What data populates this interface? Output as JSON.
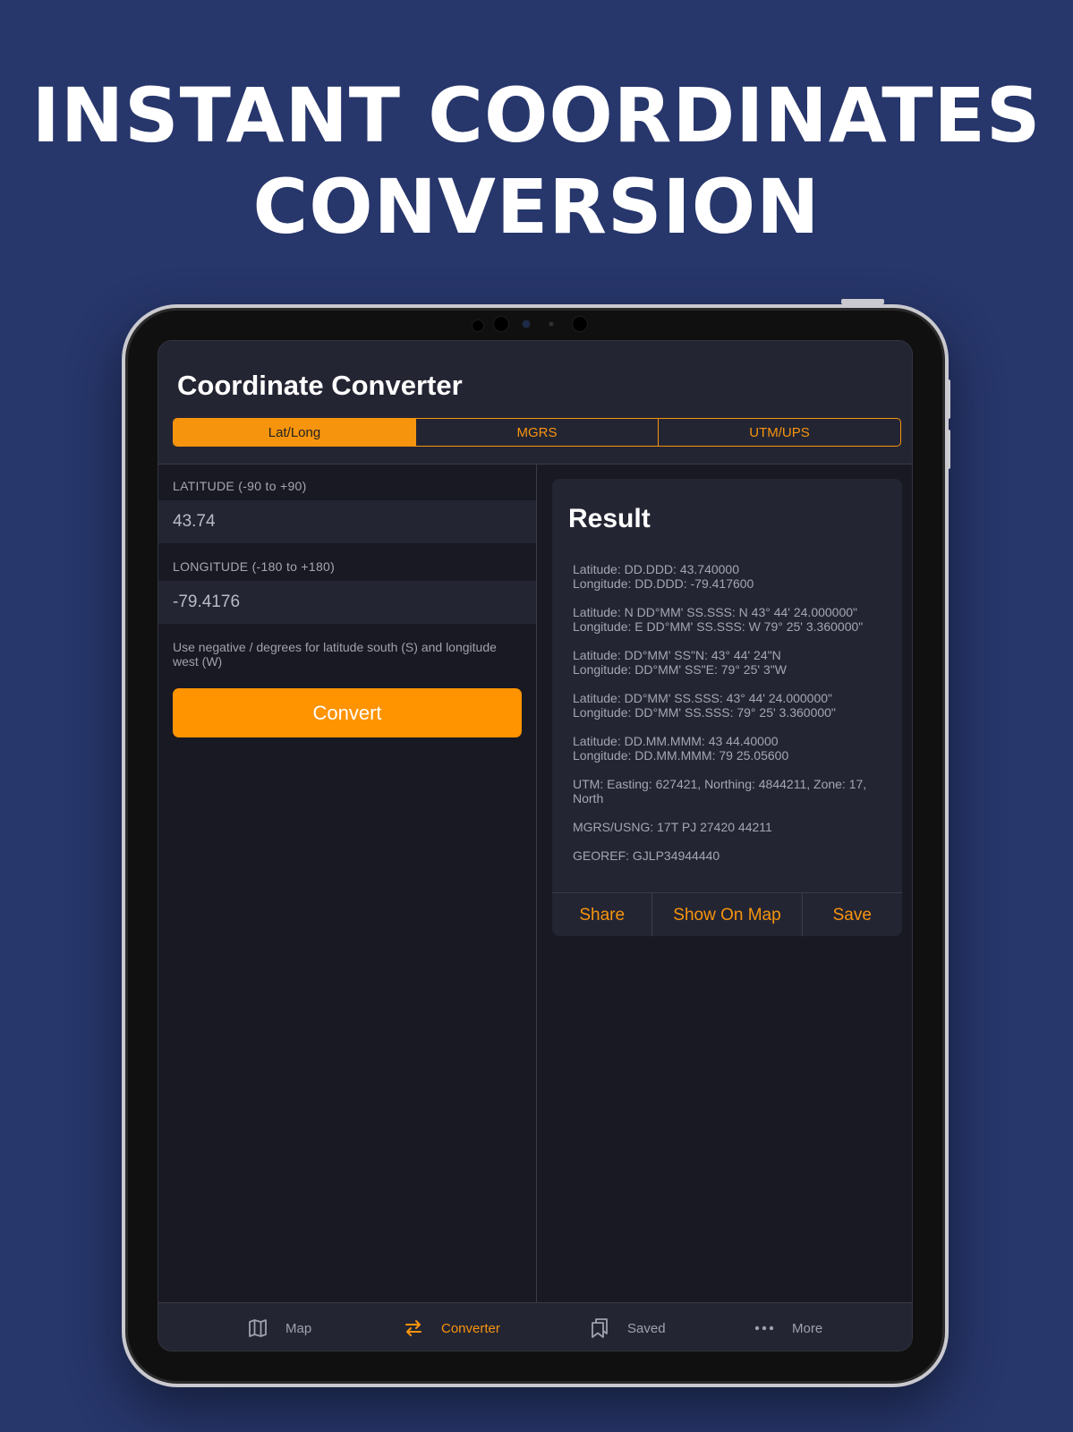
{
  "headline": {
    "line1": "INSTANT COORDINATES",
    "line2": "CONVERSION"
  },
  "app": {
    "title": "Coordinate Converter",
    "segments": [
      {
        "label": "Lat/Long",
        "active": true
      },
      {
        "label": "MGRS",
        "active": false
      },
      {
        "label": "UTM/UPS",
        "active": false
      }
    ]
  },
  "form": {
    "latitude_label": "LATITUDE (-90 to +90)",
    "latitude_value": "43.74",
    "longitude_label": "LONGITUDE (-180 to +180)",
    "longitude_value": "-79.4176",
    "hint": "Use negative / degrees for latitude south (S) and longitude west (W)",
    "convert_label": "Convert"
  },
  "result": {
    "title": "Result",
    "blocks": [
      [
        "Latitude: DD.DDD: 43.740000",
        "Longitude: DD.DDD: -79.417600"
      ],
      [
        "Latitude: N DD°MM' SS.SSS: N 43° 44' 24.000000\"",
        "Longitude: E DD°MM' SS.SSS: W 79° 25' 3.360000\""
      ],
      [
        "Latitude: DD°MM' SS\"N: 43° 44' 24\"N",
        "Longitude: DD°MM' SS\"E: 79° 25' 3\"W"
      ],
      [
        "Latitude: DD°MM' SS.SSS: 43° 44' 24.000000\"",
        "Longitude: DD°MM' SS.SSS: 79° 25' 3.360000\""
      ],
      [
        "Latitude: DD.MM.MMM: 43 44.40000",
        "Longitude: DD.MM.MMM: 79 25.05600"
      ],
      [
        "UTM: Easting: 627421, Northing: 4844211, Zone: 17, North"
      ],
      [
        "MGRS/USNG: 17T PJ 27420 44211"
      ],
      [
        "GEOREF: GJLP34944440"
      ]
    ],
    "actions": {
      "share": "Share",
      "show_on_map": "Show On Map",
      "save": "Save"
    }
  },
  "tabbar": {
    "map": "Map",
    "converter": "Converter",
    "saved": "Saved",
    "more": "More",
    "active": "converter"
  },
  "colors": {
    "background": "#27366b",
    "accent": "#f7940d",
    "button": "#ff9300",
    "panel": "#242533",
    "screen": "#181923"
  }
}
